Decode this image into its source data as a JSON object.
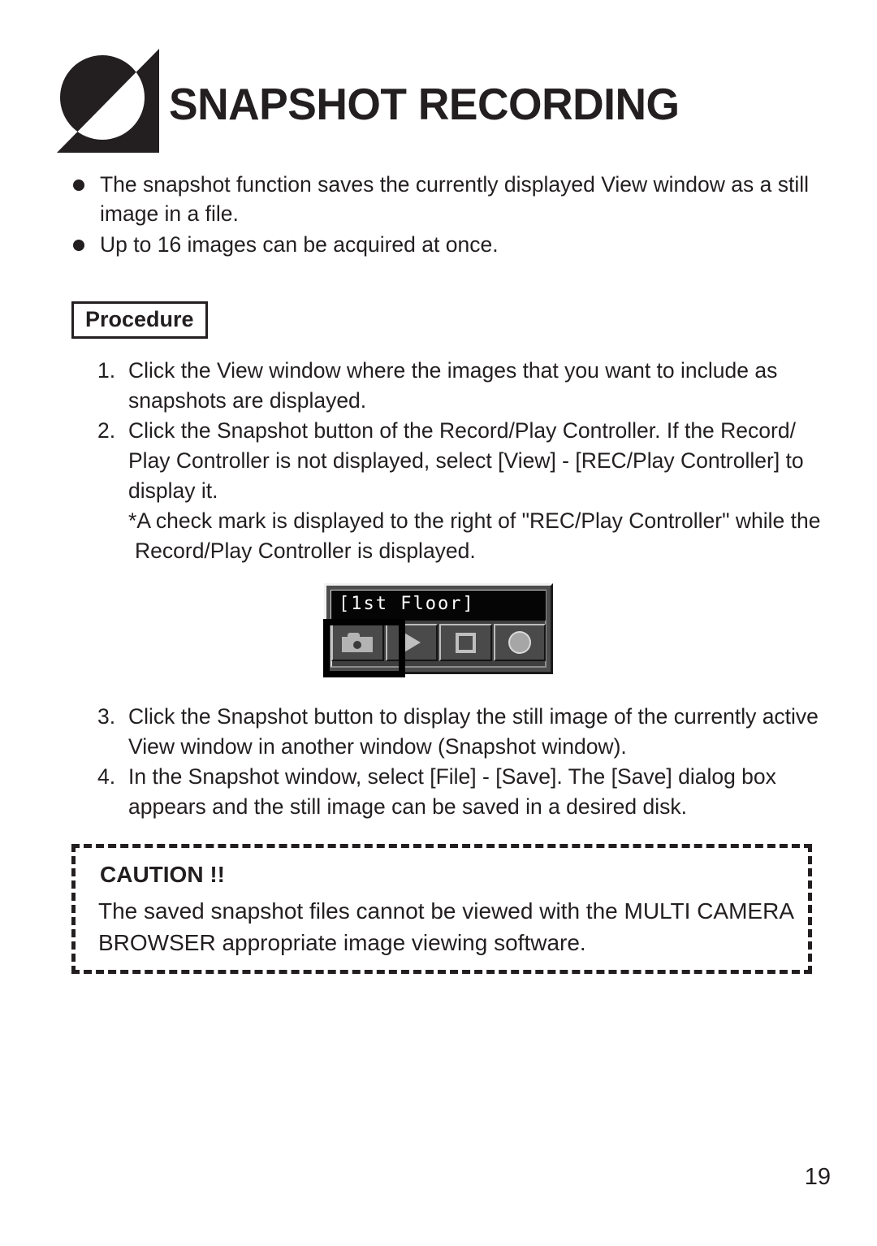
{
  "header": {
    "title": "SNAPSHOT RECORDING",
    "logo_name": "multi-camera-browser-logo"
  },
  "intro": {
    "bullets": [
      "The snapshot function saves the currently displayed View window as a still image in a file.",
      "Up to 16 images can be acquired at once."
    ]
  },
  "procedure": {
    "label": "Procedure",
    "steps": [
      {
        "number": "1.",
        "text": "Click the View window where the images that you want to include as snapshots are displayed."
      },
      {
        "number": "2.",
        "text": "Click the Snapshot button of the Record/Play Controller. If the Record/ Play Controller is not displayed, select [View] - [REC/Play Controller] to display it."
      },
      {
        "number": "3.",
        "text": "Click the Snapshot button to display the still image of the currently active View window in another window (Snapshot window)."
      },
      {
        "number": "4.",
        "text": "In the Snapshot window, select [File] - [Save]. The [Save] dialog box appears and the still image can be saved in a desired disk."
      }
    ],
    "note_line1": "*A check mark is displayed to the right of \"REC/Play Controller\" while the",
    "note_line2": "Record/Play Controller is displayed."
  },
  "controller": {
    "title": "[1st Floor]",
    "buttons": [
      {
        "name": "snapshot",
        "icon": "camera-icon"
      },
      {
        "name": "play",
        "icon": "play-icon"
      },
      {
        "name": "stop",
        "icon": "stop-icon"
      },
      {
        "name": "record",
        "icon": "record-icon"
      }
    ]
  },
  "caution": {
    "title": "CAUTION !!",
    "body": "The saved snapshot files cannot be viewed with the MULTI CAMERA BROWSER appropriate image viewing software."
  },
  "footer": {
    "page_number": "19"
  },
  "colors": {
    "ink": "#231f20",
    "page": "#ffffff",
    "widget_face": "#4a4a4a",
    "widget_titlebar": "#050505"
  }
}
